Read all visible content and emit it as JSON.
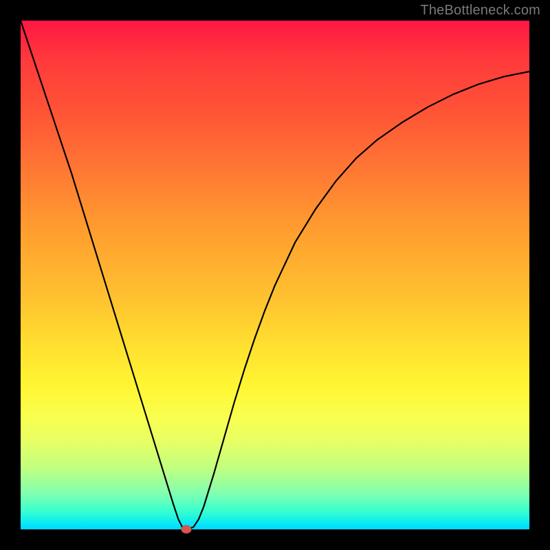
{
  "watermark": "TheBottleneck.com",
  "chart_data": {
    "type": "line",
    "title": "",
    "xlabel": "",
    "ylabel": "",
    "xlim": [
      0,
      100
    ],
    "ylim": [
      0,
      100
    ],
    "grid": false,
    "legend": false,
    "background_gradient": {
      "direction": "top-to-bottom",
      "stops": [
        {
          "pos": 0,
          "color": "#ff1744"
        },
        {
          "pos": 8,
          "color": "#ff3b3b"
        },
        {
          "pos": 18,
          "color": "#ff5436"
        },
        {
          "pos": 30,
          "color": "#ff7a33"
        },
        {
          "pos": 42,
          "color": "#ffa02f"
        },
        {
          "pos": 54,
          "color": "#ffc030"
        },
        {
          "pos": 64,
          "color": "#ffe030"
        },
        {
          "pos": 72,
          "color": "#fff633"
        },
        {
          "pos": 78,
          "color": "#f9ff4f"
        },
        {
          "pos": 83,
          "color": "#e6ff66"
        },
        {
          "pos": 88,
          "color": "#c0ff80"
        },
        {
          "pos": 93,
          "color": "#80ffb0"
        },
        {
          "pos": 97,
          "color": "#36ffd0"
        },
        {
          "pos": 99,
          "color": "#05e8f9"
        },
        {
          "pos": 100,
          "color": "#00d4ff"
        }
      ]
    },
    "series": [
      {
        "name": "bottleneck-curve",
        "color": "#000000",
        "x": [
          0,
          2,
          4,
          6,
          8,
          10,
          12,
          14,
          16,
          18,
          20,
          22,
          24,
          26,
          28,
          30,
          31,
          32,
          33,
          34,
          35,
          36,
          38,
          40,
          42,
          44,
          46,
          48,
          50,
          54,
          58,
          62,
          66,
          70,
          75,
          80,
          85,
          90,
          95,
          100
        ],
        "y": [
          100,
          94,
          88,
          82,
          76,
          70,
          63.5,
          57,
          50.5,
          44,
          37.5,
          31,
          24.5,
          18,
          11.5,
          5,
          2,
          0,
          0,
          0.5,
          2,
          4.5,
          11,
          18,
          25,
          31.5,
          37.5,
          43,
          48,
          56.5,
          63,
          68.5,
          73,
          76.5,
          80,
          83,
          85.5,
          87.5,
          89,
          90
        ]
      }
    ],
    "marker": {
      "x": 32.5,
      "y": 0,
      "color": "#d9534f"
    }
  }
}
